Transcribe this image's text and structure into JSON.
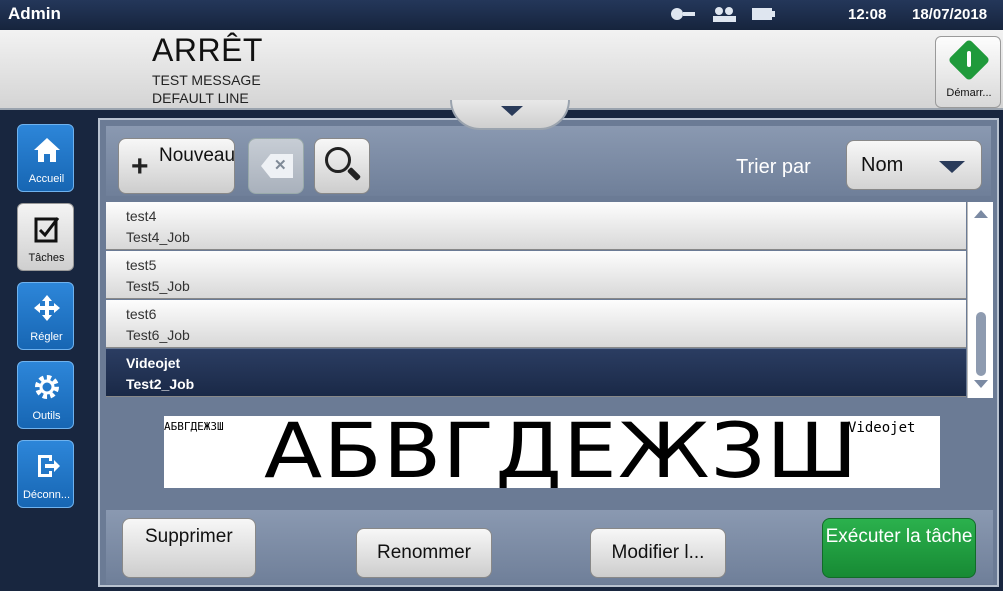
{
  "topbar": {
    "user": "Admin",
    "time": "12:08",
    "date": "18/07/2018",
    "icons": [
      "network-icon",
      "users-icon",
      "battery-icon"
    ]
  },
  "status": {
    "title": "ARRÊT",
    "line1": "TEST MESSAGE",
    "line2": "DEFAULT LINE"
  },
  "start_button": {
    "label": "Démarr..."
  },
  "sidebar": {
    "items": [
      {
        "label": "Accueil",
        "icon": "home-icon"
      },
      {
        "label": "Tâches",
        "icon": "tasks-icon"
      },
      {
        "label": "Régler",
        "icon": "move-icon"
      },
      {
        "label": "Outils",
        "icon": "gear-icon"
      },
      {
        "label": "Déconn...",
        "icon": "logout-icon"
      }
    ]
  },
  "toolbar": {
    "new_label": "Nouveau",
    "sort_label": "Trier par",
    "sort_value": "Nom"
  },
  "jobs": [
    {
      "name": "test4",
      "job": "Test4_Job"
    },
    {
      "name": "test5",
      "job": "Test5_Job"
    },
    {
      "name": "test6",
      "job": "Test6_Job"
    },
    {
      "name": "Videojet",
      "job": "Test2_Job"
    }
  ],
  "preview": {
    "small_text": "АБВГДЕЖЗШ",
    "big_text": "АБВГДЕЖЗШ",
    "tag": "Videojet"
  },
  "actions": {
    "delete": "Supprimer",
    "rename": "Renommer",
    "modify": "Modifier l...",
    "run": "Exécuter la tâche"
  },
  "colors": {
    "accent_blue": "#1f73c4",
    "run_green": "#1f9a3b",
    "selected_row": "#1f2f50"
  }
}
